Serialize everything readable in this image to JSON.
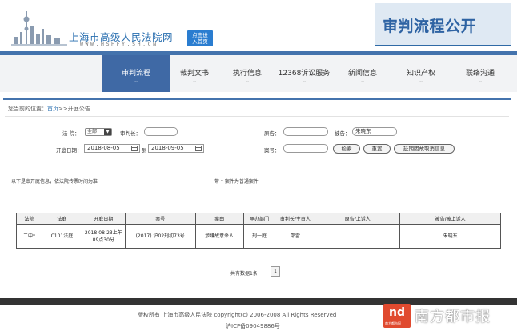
{
  "header": {
    "site_name": "上海市高级人民法院网",
    "site_url": "WWW.HSHFY.SH.CN",
    "enter_button": [
      "点击进",
      "入首页"
    ],
    "banner_title": "审判流程公开"
  },
  "nav": {
    "items": [
      {
        "label": "审判流程",
        "active": true
      },
      {
        "label": "裁判文书",
        "active": false
      },
      {
        "label": "执行信息",
        "active": false
      },
      {
        "label": "12368诉讼服务",
        "active": false
      },
      {
        "label": "新闻信息",
        "active": false
      },
      {
        "label": "知识产权",
        "active": false
      },
      {
        "label": "联络沟通",
        "active": false
      }
    ],
    "chevron": "⌄"
  },
  "breadcrumb": {
    "prefix": "您当前的位置：",
    "home": "首页",
    "separator": ">>",
    "current": "开庭公告"
  },
  "search_form": {
    "court_label": "法 院：",
    "court_value": "全部",
    "judge_label": "审判长：",
    "judge_value": "",
    "plaintiff_label": "原告：",
    "plaintiff_value": "",
    "defendant_label": "被告：",
    "defendant_value": "朱晓东",
    "date_label": "开庭日期：",
    "date_from": "2018-08-05",
    "date_to_label": "到",
    "date_to": "2018-09-05",
    "case_no_label": "案号：",
    "case_no_value": "",
    "search_button": "检索",
    "reset_button": "重置",
    "postponed_button": "延期因故取消信息"
  },
  "notices": {
    "left": "以下是审开庭信息，依法院传票时间为准",
    "right": "带 * 案件为普通案件"
  },
  "table": {
    "headers": [
      "法院",
      "法庭",
      "开庭日期",
      "案号",
      "案由",
      "承办部门",
      "审判长/主审人",
      "原告/上诉人",
      "被告/被上诉人"
    ],
    "rows": [
      {
        "court": "二中*",
        "courtroom": "C101法庭",
        "date_line1": "2018-08-23上午",
        "date_line2": "09点30分",
        "case_no": "(2017) 沪02刑初73号",
        "cause": "涉嫌故意杀人",
        "department": "刑一庭",
        "judge": "邵雷",
        "plaintiff": "",
        "defendant": "朱晓东"
      }
    ]
  },
  "pager": {
    "total_text": "共有数据1条",
    "current_page": "1"
  },
  "footer": {
    "line1": "版权所有 上海市高级人民法院 copyright(c) 2006-2008 All Rights Reserved",
    "line2": "沪ICP备09049886号"
  },
  "watermark": {
    "logo_text": "nd",
    "brand": "南方都市报",
    "sub": "南方都市报"
  },
  "colors": {
    "nav_active": "#3f69a5",
    "accent_blue": "#4473ad",
    "banner_bg": "#dfe9f3",
    "watermark_red": "#e04a2f"
  }
}
